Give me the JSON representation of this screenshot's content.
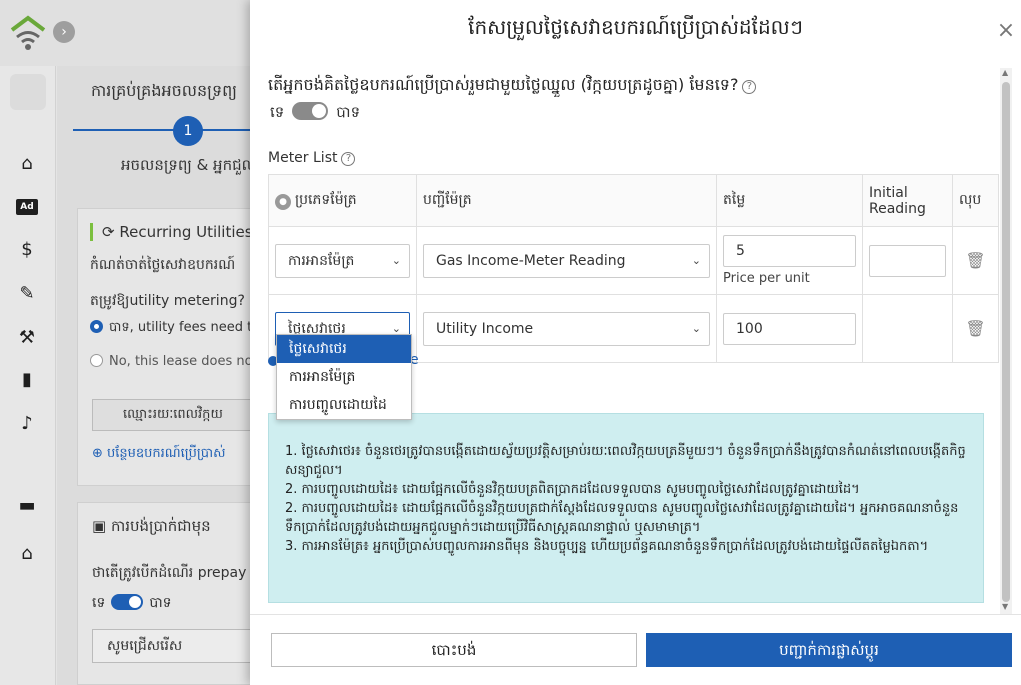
{
  "background": {
    "collapse_icon": "›",
    "heading": "ការគ្រប់គ្រងអចលនទ្រព្យ",
    "step_number": "1",
    "step_label": "អចលនទ្រព្យ & អ្នកជួល",
    "recurring_card": {
      "title": "Recurring Utilities",
      "line1": "កំណត់ចាត់ថ្លៃសេវាឧបករណ៍",
      "question": "តម្រូវឱ្យutility metering?",
      "option_yes": "បាទ, utility fees need to",
      "option_no": "No, this lease does not",
      "button_label": "ឈ្មោះរយៈពេលវិក្កយ",
      "add_link": "បន្ថែមឧបករណ៍ប្រើប្រាស់"
    },
    "prepay_card": {
      "title": "ការបង់ប្រាក់ជាមុន",
      "question": "ថាតើត្រូវបើកដំណើរ prepay",
      "toggle_no": "ទេ",
      "toggle_yes": "បាទ",
      "select_placeholder": "សូមជ្រើសរើស"
    }
  },
  "modal": {
    "title": "កែសម្រួលថ្លៃសេវាឧបករណ៍ប្រើប្រាស់ដដែលៗ",
    "close_icon": "×",
    "question": "តើអ្នកចង់គិតថ្លៃឧបករណ៍ប្រើប្រាស់រួមជាមួយថ្លៃឈ្នួល (វិក្កយបត្រដូចគ្នា) មែនទេ?",
    "toggle_no": "ទេ",
    "toggle_yes": "បាទ",
    "meter_list_label": "Meter List",
    "table": {
      "headers": {
        "type": "ប្រភេទម៉ែត្រ",
        "list": "បញ្ជីម៉ែត្រ",
        "price": "តម្លៃ",
        "initial": "Initial Reading",
        "delete": "លុប"
      },
      "rows": [
        {
          "type": "ការអានម៉ែត្រ",
          "meter": "Gas Income-Meter Reading",
          "price": "5",
          "price_sub": "Price per unit",
          "initial": ""
        },
        {
          "type": "ថ្លៃសេវាថេរ",
          "meter": "Utility Income",
          "price": "100",
          "price_sub": "",
          "initial": ""
        }
      ]
    },
    "dropdown_options": [
      "ថ្លៃសេវាថេរ",
      "ការអានម៉ែត្រ",
      "ការបញ្ចូលដោយដៃ"
    ],
    "hidden_link_tail": "e",
    "info_lines": [
      "1. ថ្លៃសេវាថេរ៖ ចំនួនថេរត្រូវបានបង្កើតដោយស្វ័យប្រវត្តិសម្រាប់រយៈពេលវិក្កយបត្រនីមួយៗ។ ចំនួនទឹកប្រាក់នឹងត្រូវបានកំណត់នៅពេលបង្កើតកិច្ចសន្យាជួល។",
      "2. ការបញ្ចូលដោយដៃ៖ ដោយផ្អែកលើចំនួនវិក្កយបត្រពិតប្រាកដដែលទទួលបាន សូមបញ្ចូលថ្លៃសេវាដែលត្រូវគ្នាដោយដៃ។",
      "2. ការបញ្ចូលដោយដៃ៖ ដោយផ្អែកលើចំនួនវិក្កយបត្រជាក់ស្តែងដែលទទួលបាន សូមបញ្ចូលថ្លៃសេវាដែលត្រូវគ្នាដោយដៃ។ អ្នកអាចគណនាចំនួនទឹកប្រាក់ដែលត្រូវបង់ដោយអ្នកជួលម្នាក់ៗដោយប្រើវិធីសាស្ត្រគណនាផ្ទាល់ ឬសមាមាត្រ។",
      "3. ការអានម៉ែត្រ៖ អ្នកប្រើប្រាស់បញ្ចូលការអានពីមុន និងបច្ចុប្បន្ន ហើយប្រព័ន្ធគណនាចំនួនទឹកប្រាក់ដែលត្រូវបង់ដោយផ្ទៃលីតតម្លៃឯកតា។"
    ],
    "cancel_label": "បោះបង់",
    "save_label": "បញ្ជាក់ការផ្លាស់ប្តូរ"
  },
  "colors": {
    "primary": "#1e5fb4",
    "info_bg": "#cfeef0",
    "accent_green": "#7bbf3e"
  }
}
